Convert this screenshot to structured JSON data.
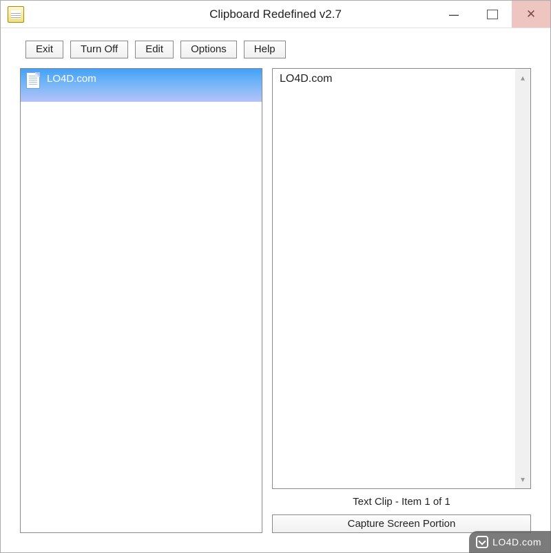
{
  "window": {
    "title": "Clipboard Redefined v2.7"
  },
  "toolbar": {
    "exit_label": "Exit",
    "turn_off_label": "Turn Off",
    "edit_label": "Edit",
    "options_label": "Options",
    "help_label": "Help"
  },
  "clips": {
    "items": [
      {
        "label": "LO4D.com"
      }
    ],
    "selected_index": 0
  },
  "preview": {
    "text": "LO4D.com",
    "status": "Text Clip - Item 1 of 1",
    "capture_label": "Capture Screen Portion"
  },
  "watermark": {
    "text": "LO4D.com"
  }
}
